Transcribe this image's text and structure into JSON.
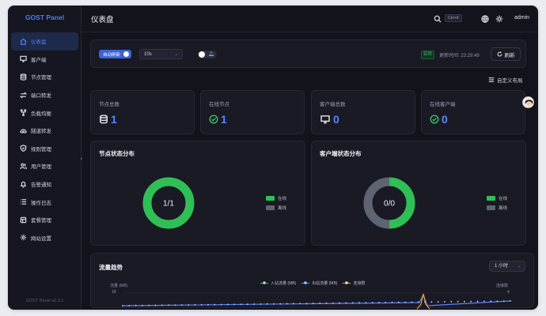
{
  "app": {
    "brand": "GOST Panel",
    "version": "GOST Panel v2.3.1"
  },
  "header": {
    "title": "仪表盘",
    "shortcut": "Ctrl+K",
    "user": "admin"
  },
  "sidebar": {
    "items": [
      {
        "label": "仪表盘",
        "icon": "home-icon",
        "active": true
      },
      {
        "label": "客户端",
        "icon": "monitor-icon"
      },
      {
        "label": "节点管理",
        "icon": "database-icon"
      },
      {
        "label": "端口转发",
        "icon": "swap-icon"
      },
      {
        "label": "负载均衡",
        "icon": "fork-icon"
      },
      {
        "label": "隧道转发",
        "icon": "tunnel-icon"
      },
      {
        "label": "规则管理",
        "icon": "shield-icon"
      },
      {
        "label": "用户管理",
        "icon": "users-icon"
      },
      {
        "label": "告警通知",
        "icon": "bell-icon"
      },
      {
        "label": "操作日志",
        "icon": "list-icon"
      },
      {
        "label": "套餐管理",
        "icon": "box-icon"
      },
      {
        "label": "网站设置",
        "icon": "gear-icon"
      }
    ]
  },
  "toolbar": {
    "auto_refresh_label": "自动刷新",
    "interval": "10s",
    "live_badge": "实时",
    "updated": "更新时间: 23:29:49",
    "refresh_label": "刷新",
    "custom_layout": "自定义布局"
  },
  "stats": [
    {
      "label": "节点总数",
      "value": "1",
      "icon": "database-icon",
      "color": "#5b86ff"
    },
    {
      "label": "在线节点",
      "value": "1",
      "icon": "check-circle-icon",
      "color": "#3bc46a"
    },
    {
      "label": "客户端总数",
      "value": "0",
      "icon": "monitor-icon",
      "color": "#e6e8ee"
    },
    {
      "label": "在线客户端",
      "value": "0",
      "icon": "check-circle-icon",
      "color": "#3bc46a"
    }
  ],
  "node_status": {
    "title": "节点状态分布",
    "center": "1/1",
    "legend": [
      {
        "label": "在线",
        "color": "#2fbf56"
      },
      {
        "label": "离线",
        "color": "#5e6472"
      }
    ]
  },
  "client_status": {
    "title": "客户端状态分布",
    "center": "0/0",
    "legend": [
      {
        "label": "在线",
        "color": "#2fbf56"
      },
      {
        "label": "离线",
        "color": "#5e6472"
      }
    ]
  },
  "traffic": {
    "title": "流量趋势",
    "range": "1 小时",
    "left_axis_name": "流量 (MB)",
    "right_axis_name": "连接数",
    "left_top_tick": "18",
    "right_top_tick": "4",
    "series": [
      {
        "name": "入站流量 (MB)",
        "color": "#3bc46a"
      },
      {
        "name": "出站流量 (MB)",
        "color": "#5b86ff"
      },
      {
        "name": "连接数",
        "color": "#f0a020"
      }
    ]
  }
}
